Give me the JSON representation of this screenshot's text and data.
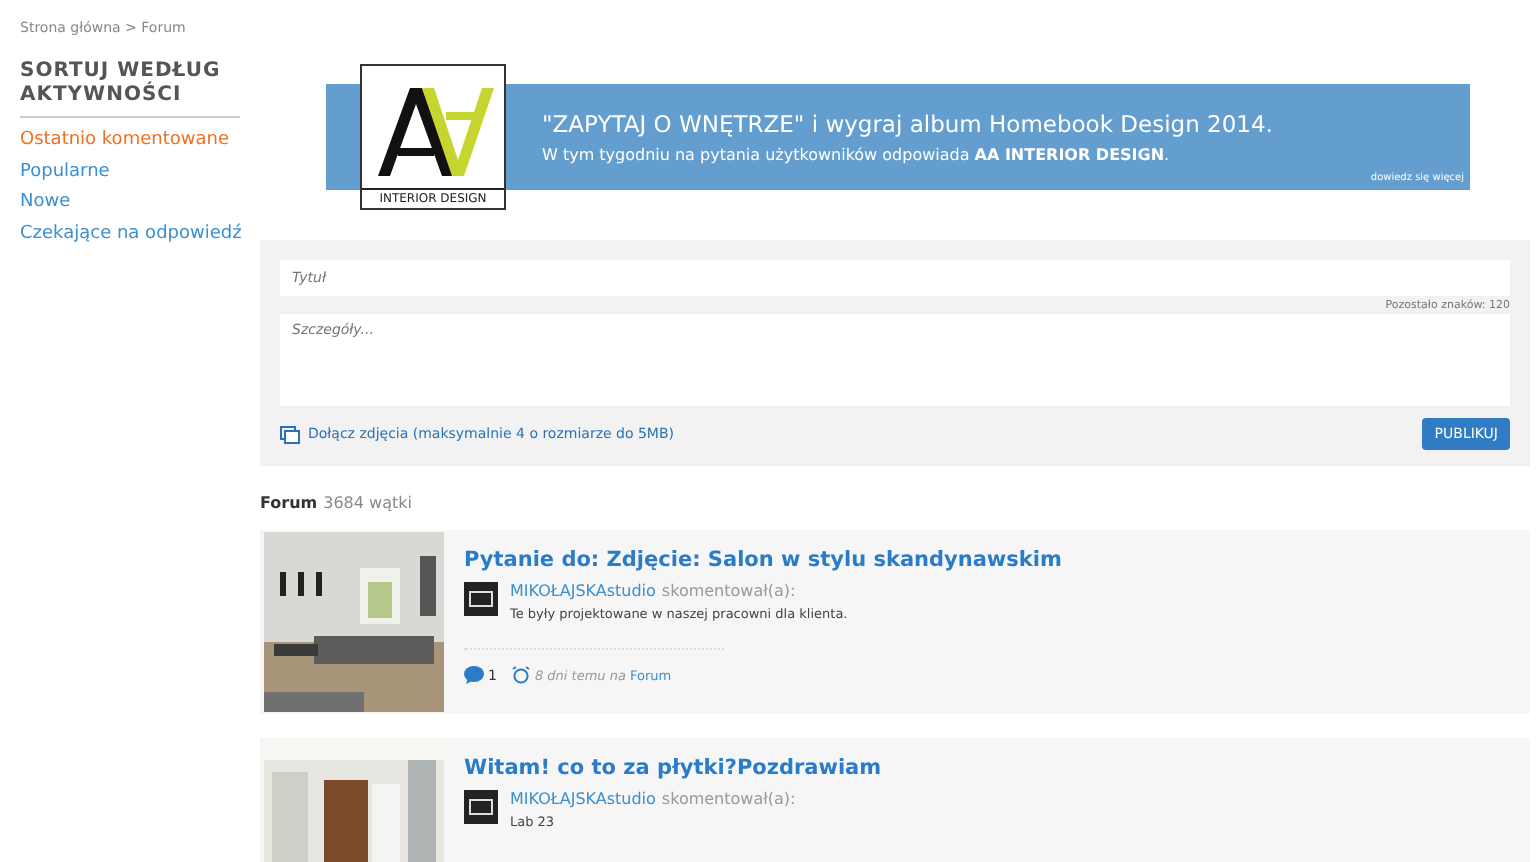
{
  "breadcrumb": {
    "items": [
      "Strona główna",
      "Forum"
    ],
    "separator": ">"
  },
  "sidebar": {
    "title": "SORTUJ WEDŁUG AKTYWNOŚCI",
    "items": [
      {
        "label": "Ostatnio komentowane",
        "selected": true
      },
      {
        "label": "Popularne",
        "selected": false
      },
      {
        "label": "Nowe",
        "selected": false
      },
      {
        "label": "Czekające na odpowiedź",
        "selected": false
      }
    ]
  },
  "banner": {
    "logo_text": "INTERIOR DESIGN",
    "headline": "\"ZAPYTAJ O WNĘTRZE\" i wygraj album Homebook Design 2014.",
    "subline": "W tym tygodniu na pytania użytkowników odpowiada **AA INTERIOR DESIGN**.",
    "more_link": "dowiedz się więcej"
  },
  "form": {
    "title_placeholder": "Tytuł",
    "chars_left": "Pozostało znaków: 120",
    "details_placeholder": "Szczegóły...",
    "attach_link": "Dołącz zdjęcia (maksymalnie 4 o rozmiarze do 5MB)",
    "submit": "PUBLIKUJ"
  },
  "forum_header": {
    "label": "Forum",
    "count": "3684 wątki"
  },
  "posts": [
    {
      "title": "Pytanie do: Zdjęcie: Salon w stylu skandynawskim",
      "author": "MIKOŁAJSKAstudio",
      "action": "skomentował(a):",
      "excerpt": "Te były projektowane w naszej pracowni dla klienta.",
      "comments": "1",
      "time": "8 dni temu na",
      "category": "Forum",
      "kind": "living"
    },
    {
      "title": "Witam! co to za płytki?Pozdrawiam",
      "author": "MIKOŁAJSKAstudio",
      "action": "skomentował(a):",
      "excerpt": "Lab 23",
      "kind": "bathroom"
    }
  ]
}
